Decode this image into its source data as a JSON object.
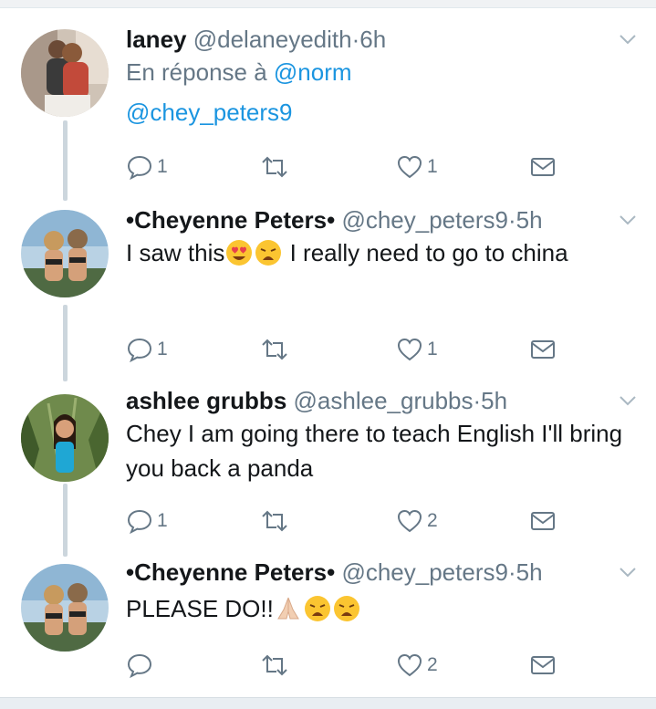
{
  "tweets": [
    {
      "name": "laney",
      "handle": "@delaneyedith",
      "separator": "·",
      "time": "6h",
      "reply_prefix": "En réponse à",
      "reply_mention": "@norm",
      "text": "@chey_peters9",
      "replies": "1",
      "retweets": "",
      "likes": "1"
    },
    {
      "name": "•Cheyenne Peters•",
      "handle": "@chey_peters9",
      "separator": "·",
      "time": "5h",
      "text_a": "I saw this",
      "text_b": " I really need to go to china",
      "emojis": [
        "heart-eyes-emoji",
        "weary-emoji"
      ],
      "replies": "1",
      "retweets": "",
      "likes": "1"
    },
    {
      "name": "ashlee grubbs",
      "handle": "@ashlee_grubbs",
      "separator": "·",
      "time": "5h",
      "text": "Chey I am going there to teach English I'll bring you back a panda",
      "replies": "1",
      "retweets": "",
      "likes": "2"
    },
    {
      "name": "•Cheyenne Peters•",
      "handle": "@chey_peters9",
      "separator": "·",
      "time": "5h",
      "text": "PLEASE DO!!",
      "emojis": [
        "folded-hands-emoji",
        "weary-emoji",
        "weary-emoji"
      ],
      "replies": "",
      "retweets": "",
      "likes": "2"
    }
  ],
  "colors": {
    "text": "#14171a",
    "muted": "#657786",
    "link": "#1b95e0",
    "thread_line": "#ccd6dd"
  }
}
